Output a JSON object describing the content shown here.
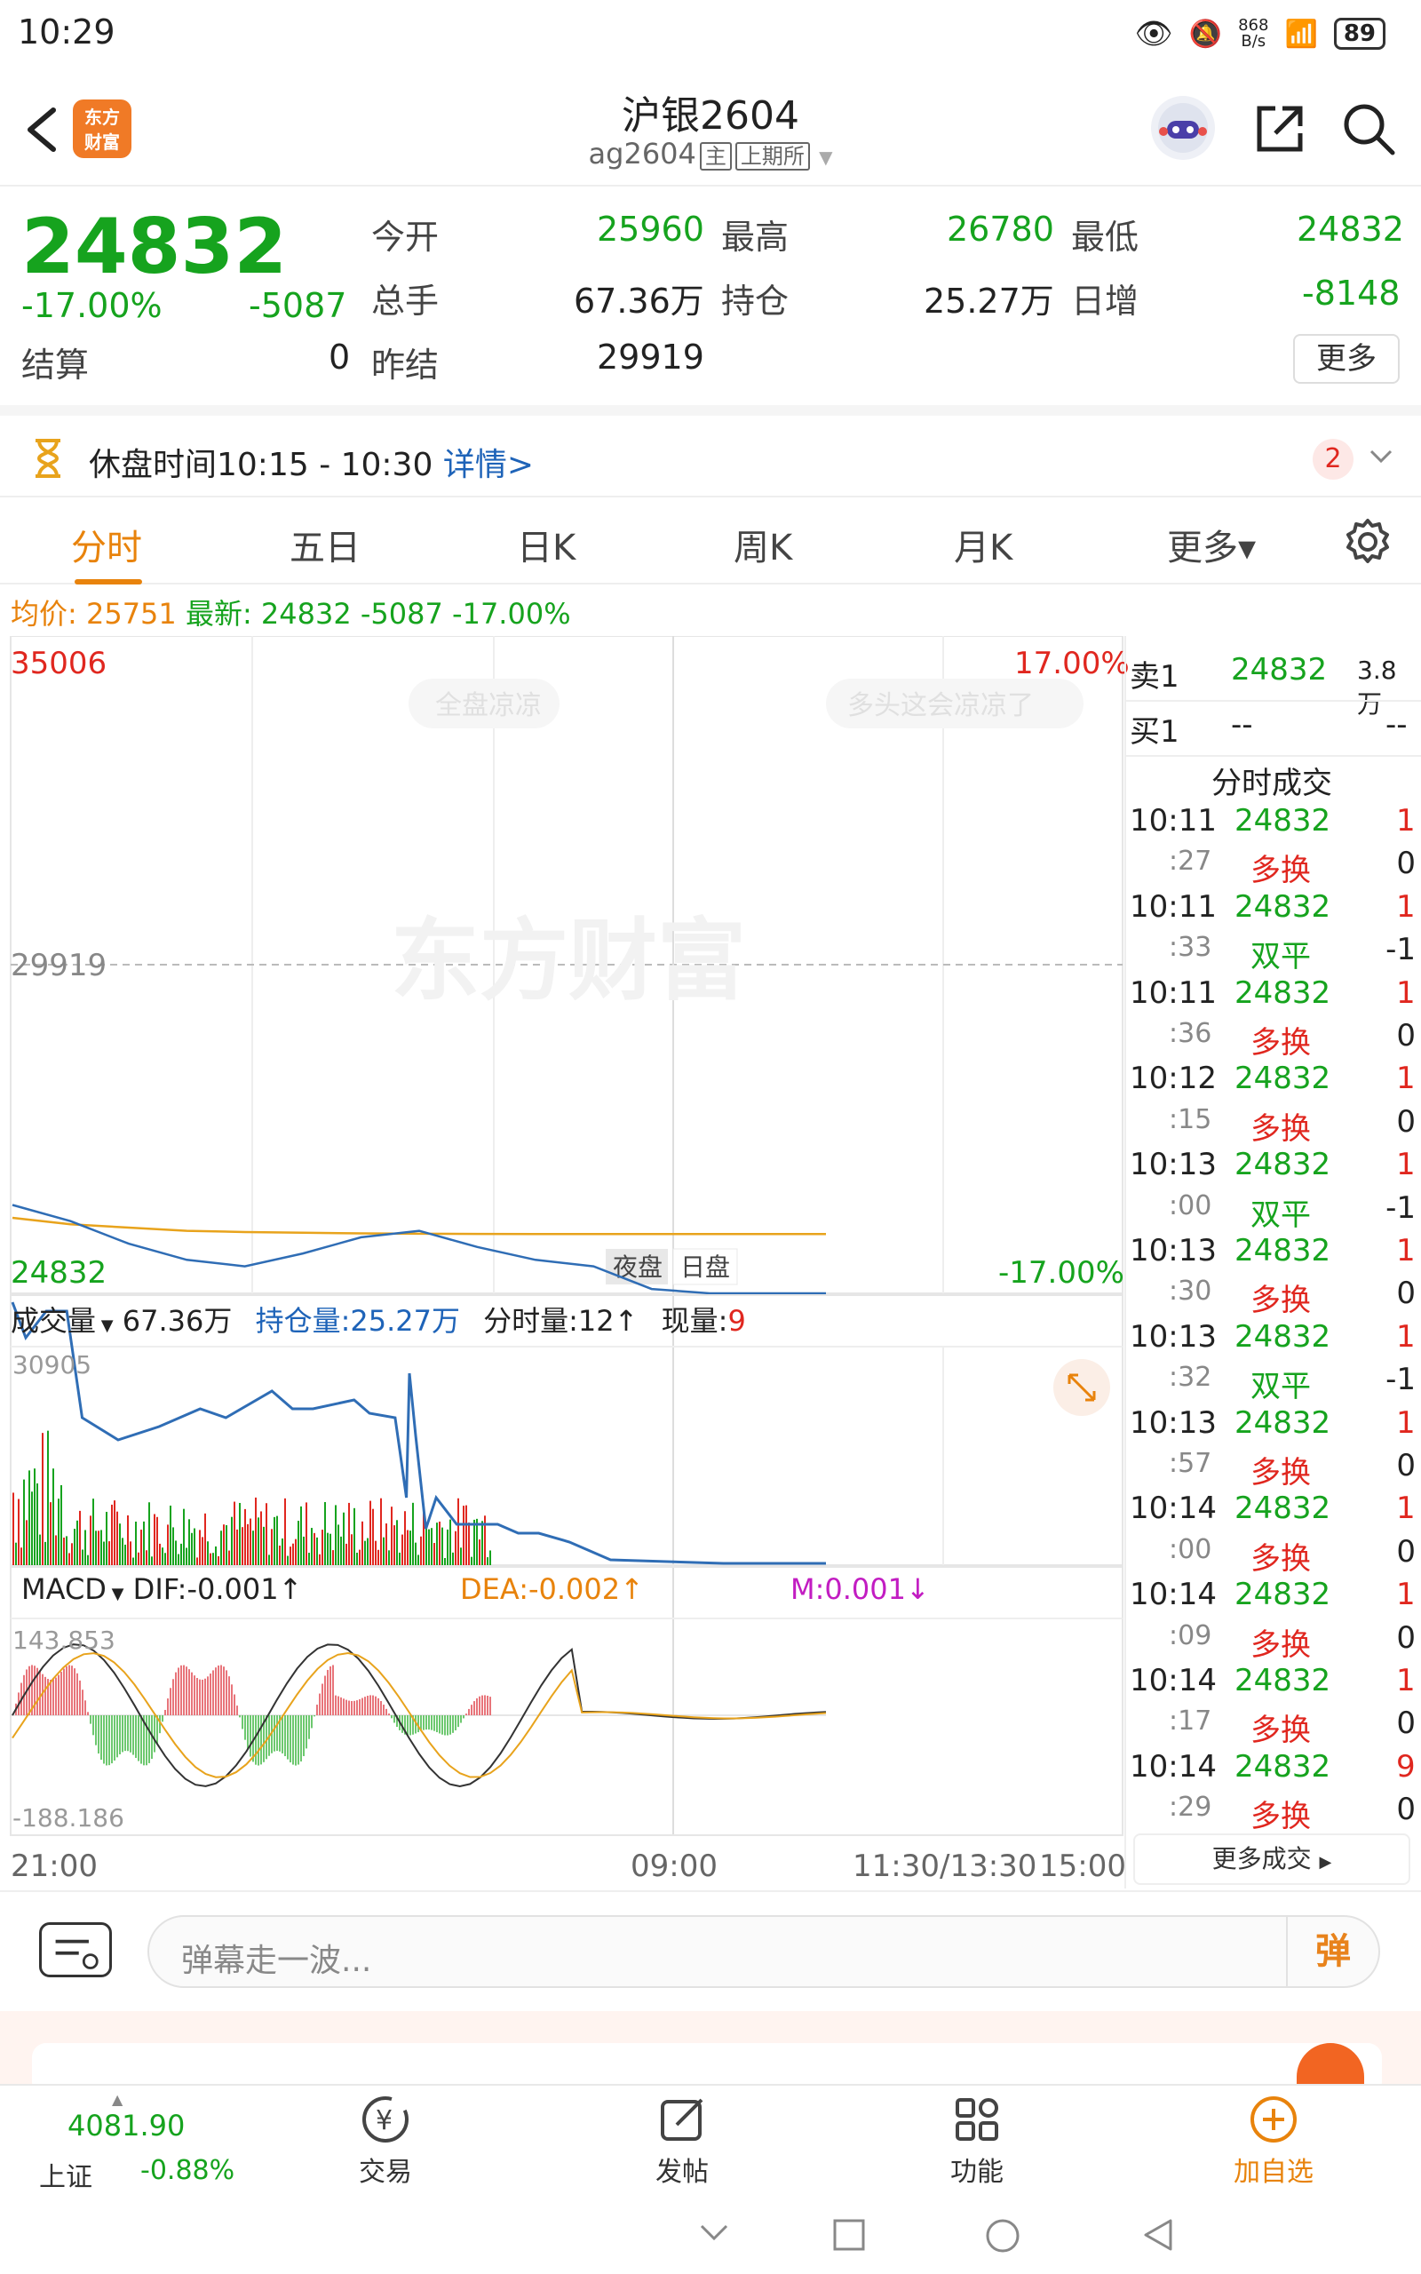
{
  "status_bar": {
    "time": "10:29",
    "net_speed": "868\nB/s",
    "battery": "89"
  },
  "header": {
    "logo_text": "东方\n财富",
    "title": "沪银2604",
    "code": "ag2604",
    "tag_main": "主",
    "tag_exchange": "上期所"
  },
  "quote": {
    "last": "24832",
    "pct": "-17.00%",
    "change": "-5087",
    "settle_label": "结算",
    "settle": "0",
    "open_label": "今开",
    "open": "25960",
    "volume_label": "总手",
    "volume": "67.36万",
    "prev_settle_label": "昨结",
    "prev_settle": "29919",
    "high_label": "最高",
    "high": "26780",
    "oi_label": "持仓",
    "oi": "25.27万",
    "low_label": "最低",
    "low": "24832",
    "daily_inc_label": "日增",
    "daily_inc": "-8148",
    "more": "更多"
  },
  "break_bar": {
    "text": "休盘时间10:15 - 10:30",
    "link": "详情>",
    "badge": "2"
  },
  "tabs": [
    "分时",
    "五日",
    "日K",
    "周K",
    "月K",
    "更多▾"
  ],
  "price_info": {
    "avg_label": "均价:",
    "avg": "25751",
    "latest_label": "最新:",
    "latest": "24832",
    "change": "-5087",
    "pct": "-17.00%"
  },
  "chart_labels": {
    "top_price": "35006",
    "top_pct": "17.00%",
    "mid_price": "29919",
    "bottom_price": "24832",
    "bottom_pct": "-17.00%",
    "watermark": "东方财富",
    "bubble1": "全盘凉凉",
    "bubble2": "多头这会凉凉了",
    "night_label": "夜盘",
    "day_label": "日盘"
  },
  "volume_panel": {
    "selector": "成交量",
    "vol": "67.36万",
    "oi_label": "持仓量:25.27万",
    "tick_vol": "分时量:12↑",
    "cur_label": "现量:",
    "cur": "9",
    "max": "30905"
  },
  "macd_panel": {
    "selector": "MACD",
    "dif": "DIF:-0.001↑",
    "dea": "DEA:-0.002↑",
    "m": "M:0.001↓",
    "max": "143.853",
    "min": "-188.186"
  },
  "time_axis": [
    "21:00",
    "09:00",
    "11:30/13:30",
    "15:00"
  ],
  "order_book": {
    "sell_label": "卖1",
    "sell_price": "24832",
    "sell_vol": "3.8万",
    "buy_label": "买1",
    "buy_price": "--",
    "buy_vol": "--",
    "trades_title": "分时成交",
    "more_trades": "更多成交"
  },
  "trades": [
    {
      "t": "10:11",
      "p": "24832",
      "v": "1",
      "s": ":27",
      "kind": "多换",
      "d": "0"
    },
    {
      "t": "10:11",
      "p": "24832",
      "v": "1",
      "s": ":33",
      "kind": "双平",
      "d": "-1"
    },
    {
      "t": "10:11",
      "p": "24832",
      "v": "1",
      "s": ":36",
      "kind": "多换",
      "d": "0"
    },
    {
      "t": "10:12",
      "p": "24832",
      "v": "1",
      "s": ":15",
      "kind": "多换",
      "d": "0"
    },
    {
      "t": "10:13",
      "p": "24832",
      "v": "1",
      "s": ":00",
      "kind": "双平",
      "d": "-1"
    },
    {
      "t": "10:13",
      "p": "24832",
      "v": "1",
      "s": ":30",
      "kind": "多换",
      "d": "0"
    },
    {
      "t": "10:13",
      "p": "24832",
      "v": "1",
      "s": ":32",
      "kind": "双平",
      "d": "-1"
    },
    {
      "t": "10:13",
      "p": "24832",
      "v": "1",
      "s": ":57",
      "kind": "多换",
      "d": "0"
    },
    {
      "t": "10:14",
      "p": "24832",
      "v": "1",
      "s": ":00",
      "kind": "多换",
      "d": "0"
    },
    {
      "t": "10:14",
      "p": "24832",
      "v": "1",
      "s": ":09",
      "kind": "多换",
      "d": "0"
    },
    {
      "t": "10:14",
      "p": "24832",
      "v": "1",
      "s": ":17",
      "kind": "多换",
      "d": "0"
    },
    {
      "t": "10:14",
      "p": "24832",
      "v": "9",
      "s": ":29",
      "kind": "多换",
      "d": "0"
    }
  ],
  "comment": {
    "placeholder": "弹幕走一波...",
    "send": "弹"
  },
  "bottom_nav": {
    "index_value": "4081.90",
    "index_name": "上证",
    "index_pct": "-0.88%",
    "trade": "交易",
    "post": "发帖",
    "func": "功能",
    "add": "加自选"
  },
  "chart_data": {
    "type": "line",
    "title": "",
    "ylim": [
      24832,
      35006
    ],
    "reference": 29919,
    "series": [
      {
        "name": "最新",
        "values": [
          26200,
          25950,
          25600,
          25350,
          25250,
          25450,
          25700,
          25800,
          25550,
          25350,
          25250,
          24900,
          24832,
          24832,
          24832
        ]
      },
      {
        "name": "均价",
        "values": [
          26000,
          25900,
          25850,
          25800,
          25780,
          25770,
          25760,
          25755,
          25752,
          25751,
          25751,
          25751,
          25751,
          25751,
          25751
        ]
      }
    ]
  }
}
